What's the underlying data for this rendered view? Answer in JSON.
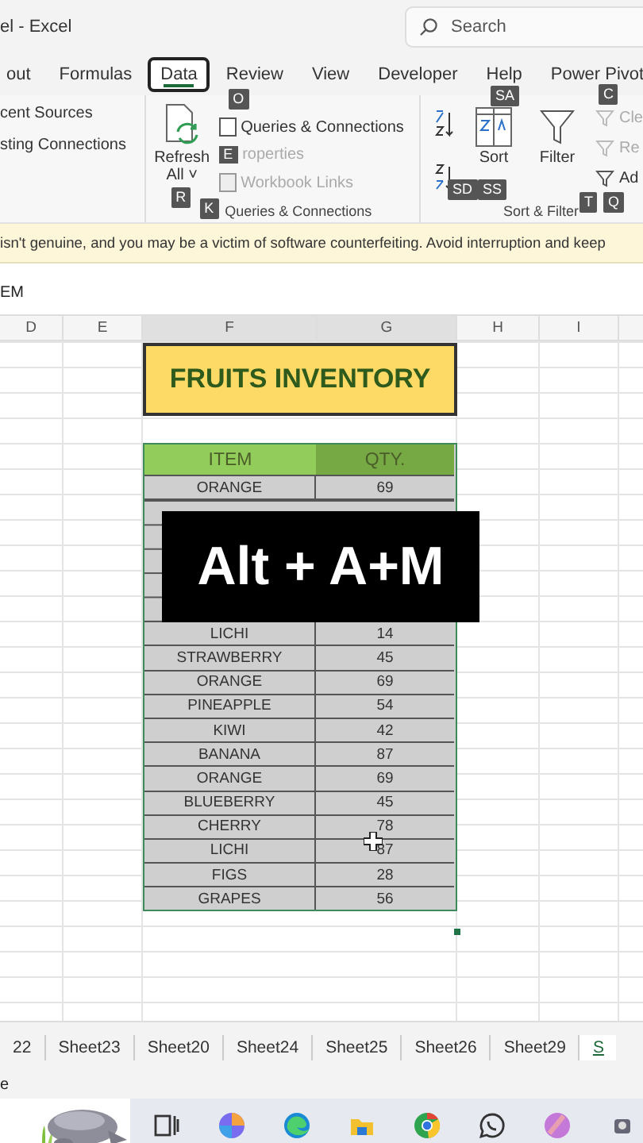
{
  "window": {
    "title": "el - Excel",
    "search": {
      "placeholder": "Search"
    }
  },
  "tabs": [
    {
      "label": "out",
      "selected": false
    },
    {
      "label": "Formulas",
      "selected": false
    },
    {
      "label": "Data",
      "selected": true
    },
    {
      "label": "Review",
      "selected": false
    },
    {
      "label": "View",
      "selected": false
    },
    {
      "label": "Developer",
      "selected": false
    },
    {
      "label": "Help",
      "selected": false
    },
    {
      "label": "Power Pivot",
      "selected": false
    }
  ],
  "ribbon": {
    "get_data": {
      "items": [
        "cent Sources",
        "sting Connections"
      ]
    },
    "queries": {
      "refresh": {
        "label": "Refresh",
        "sub": "All ˅",
        "keytip": "R"
      },
      "items": [
        {
          "label": "Queries & Connections",
          "disabled": false,
          "keytip": "O"
        },
        {
          "label": "roperties",
          "disabled": true,
          "keytip": "E"
        },
        {
          "label": "Workbook Links",
          "disabled": true
        }
      ],
      "group_label": "Queries & Connections",
      "group_keytip": "K"
    },
    "sort_filter": {
      "sort_keytips": [
        "SA",
        "SD",
        "SS"
      ],
      "sort_label": "Sort",
      "filter_label": "Filter",
      "filter_keytip": "T",
      "side_items": [
        {
          "label": "Cle",
          "disabled": true,
          "keytip": "C"
        },
        {
          "label": "Re",
          "disabled": true
        },
        {
          "label": "Ad",
          "disabled": false,
          "keytip": "Q"
        }
      ],
      "group_label": "Sort & Filter"
    }
  },
  "warning_bar": {
    "message": "isn't genuine, and you may be a victim of software counterfeiting. Avoid interruption and keep"
  },
  "formula_bar": {
    "value": "EM"
  },
  "sheet": {
    "columns": [
      "D",
      "E",
      "F",
      "G",
      "H",
      "I"
    ],
    "title": "FRUITS INVENTORY",
    "table": {
      "columns": [
        "ITEM",
        "QTY."
      ],
      "rows_above_caption": [
        {
          "item": "ORANGE",
          "qty": "69"
        }
      ],
      "rows": [
        {
          "item": "LICHI",
          "qty": "14"
        },
        {
          "item": "STRAWBERRY",
          "qty": "45"
        },
        {
          "item": "ORANGE",
          "qty": "69"
        },
        {
          "item": "PINEAPPLE",
          "qty": "54"
        },
        {
          "item": "KIWI",
          "qty": "42"
        },
        {
          "item": "BANANA",
          "qty": "87"
        },
        {
          "item": "ORANGE",
          "qty": "69"
        },
        {
          "item": "BLUEBERRY",
          "qty": "45"
        },
        {
          "item": "CHERRY",
          "qty": "78"
        },
        {
          "item": "LICHI",
          "qty": "87"
        },
        {
          "item": "FIGS",
          "qty": "28"
        },
        {
          "item": "GRAPES",
          "qty": "56"
        }
      ]
    },
    "caption": "Alt + A+M"
  },
  "sheet_tabs": [
    {
      "label": "22",
      "selected": false
    },
    {
      "label": "Sheet23",
      "selected": false
    },
    {
      "label": "Sheet20",
      "selected": false
    },
    {
      "label": "Sheet24",
      "selected": false
    },
    {
      "label": "Sheet25",
      "selected": false
    },
    {
      "label": "Sheet26",
      "selected": false
    },
    {
      "label": "Sheet29",
      "selected": false
    },
    {
      "label": "S",
      "selected": true
    }
  ],
  "status_bar": {
    "text": "e"
  },
  "taskbar": {
    "apps": [
      {
        "kind": "taskview"
      },
      {
        "kind": "copilot"
      },
      {
        "kind": "edge"
      },
      {
        "kind": "files"
      },
      {
        "kind": "chrome"
      },
      {
        "kind": "whatsapp"
      },
      {
        "kind": "orb"
      },
      {
        "kind": "tray"
      }
    ]
  }
}
